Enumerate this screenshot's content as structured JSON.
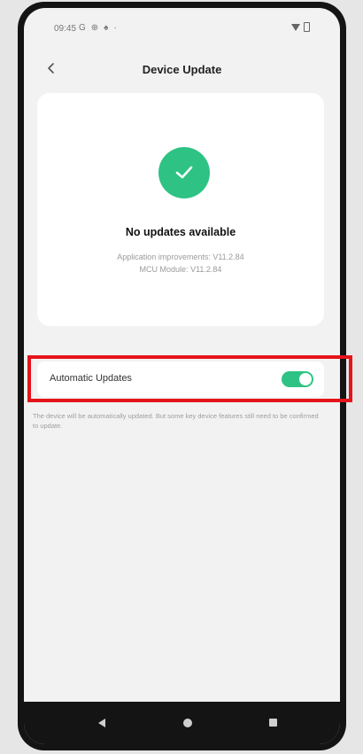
{
  "status_bar": {
    "time": "09:45",
    "left_icons": [
      "G",
      "⊕",
      "♠",
      "·"
    ]
  },
  "header": {
    "title": "Device Update",
    "back_icon": "chevron-left-icon"
  },
  "update_card": {
    "status_icon": "check-circle-icon",
    "status_title": "No updates available",
    "versions": [
      "Application improvements: V11.2.84",
      "MCU Module: V11.2.84"
    ]
  },
  "auto_update": {
    "label": "Automatic Updates",
    "enabled": true,
    "note": "The device will be automatically updated. But some key device features still need to be confirmed to update."
  },
  "colors": {
    "accent": "#2ec384",
    "highlight": "#e5141a",
    "background": "#f2f2f2"
  }
}
